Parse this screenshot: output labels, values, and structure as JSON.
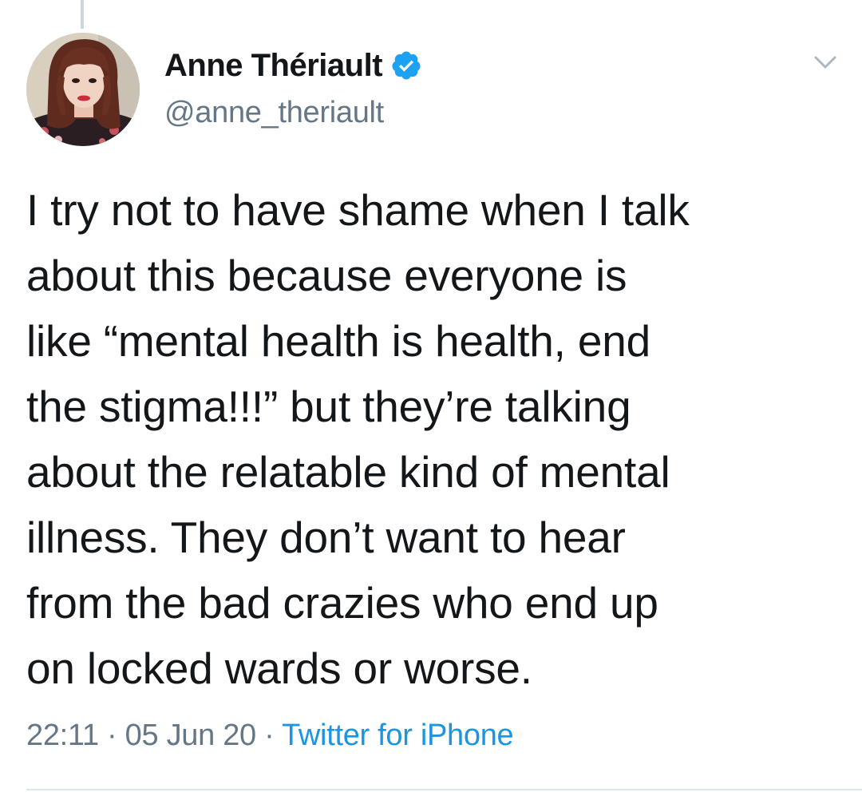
{
  "tweet": {
    "author": {
      "display_name": "Anne Thériault",
      "handle": "@anne_theriault",
      "verified": true,
      "avatar_icon": "profile-photo"
    },
    "text": "I try not to have shame when I talk\nabout this because everyone is\nlike “mental health is health, end\nthe stigma!!!” but they’re talking\nabout the relatable kind of mental\nillness. They don’t want to hear\nfrom the bad crazies who end up\non locked wards or worse.",
    "time": "22:11",
    "date": "05 Jun 20",
    "separator": "·",
    "source": "Twitter for iPhone",
    "menu_icon": "chevron-down-icon"
  },
  "colors": {
    "text_primary": "#14171a",
    "text_secondary": "#657786",
    "link": "#1b95e0",
    "verified": "#1da1f2",
    "divider": "#e1e8ed"
  }
}
